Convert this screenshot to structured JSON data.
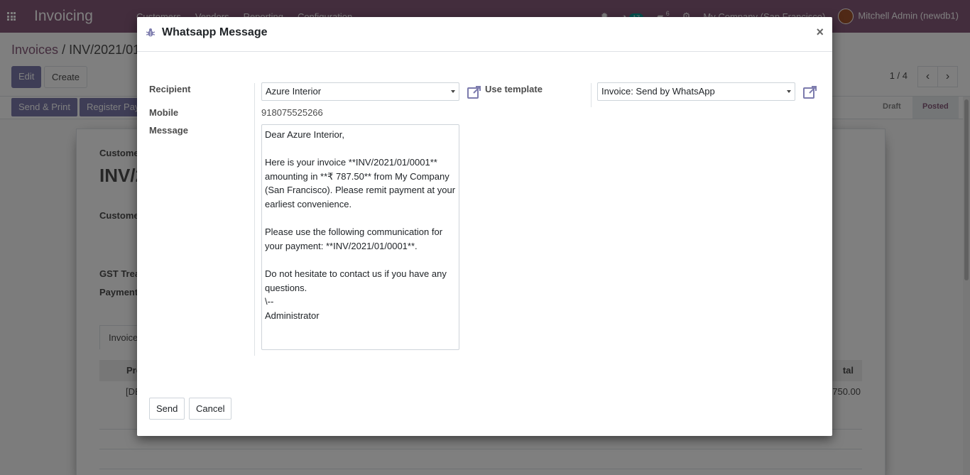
{
  "navbar": {
    "app_name": "Invoicing",
    "menu": [
      "Customers",
      "Vendors",
      "Reporting",
      "Configuration"
    ],
    "activity_count": "17",
    "message_count": "6",
    "company": "My Company (San Francisco)",
    "user": "Mitchell Admin (newdb1)"
  },
  "control_panel": {
    "breadcrumb_parent": "Invoices",
    "breadcrumb_current": "INV/2021/01",
    "edit_label": "Edit",
    "create_label": "Create",
    "pager": "1 / 4"
  },
  "statusbar": {
    "send_print_label": "Send & Print",
    "register_payment_label": "Register Pay",
    "stages": [
      "Draft",
      "Posted"
    ],
    "active_stage": "Posted"
  },
  "sheet": {
    "customer_type_label": "Custome",
    "title": "INV/2",
    "customer_label": "Custome",
    "gst_label": "GST Trea",
    "payment_label": "Payment",
    "tab_label": "Invoice",
    "col_product": "Pro",
    "col_total": "tal",
    "row_product": "[DE",
    "row_total": "750.00"
  },
  "modal": {
    "title": "Whatsapp Message",
    "close_symbol": "×",
    "recipient_label": "Recipient",
    "recipient_value": "Azure Interior",
    "use_template_label": "Use template",
    "template_value": "Invoice: Send by WhatsApp",
    "mobile_label": "Mobile",
    "mobile_value": "918075525266",
    "message_label": "Message",
    "message_value": "Dear Azure Interior,\n\nHere is your invoice **INV/2021/01/0001** amounting in **₹ 787.50** from My Company (San Francisco). Please remit payment at your earliest convenience.\n\nPlease use the following communication for your payment: **INV/2021/01/0001**.\n\nDo not hesitate to contact us if you have any questions.\n\\--\nAdministrator",
    "send_label": "Send",
    "cancel_label": "Cancel"
  },
  "colors": {
    "brand": "#875a7b",
    "primary_button": "#7c7bad",
    "backdrop": "rgba(0,0,0,0.5)"
  }
}
